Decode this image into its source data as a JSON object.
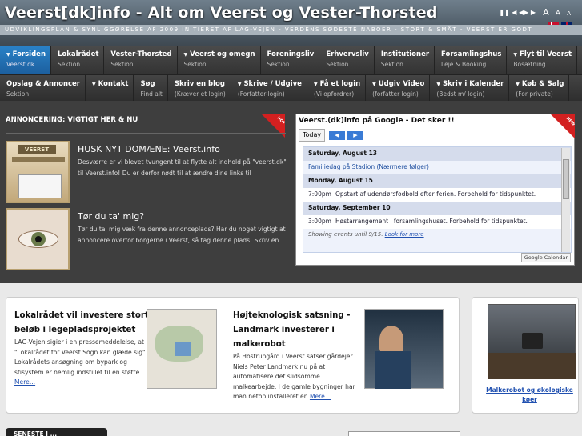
{
  "header": {
    "title": "Veerst[dk]info - Alt om Veerst og Vester-Thorsted",
    "tagline": "UDVIKLINGSPLAN & SYNLIGGØRELSE AF 2009 INITIERET AF LAG-VEJEN - VERDENS SØDESTE NABOER - STORT & SMÅT - VEERST ER GODT",
    "slideshow_controls": "❚❚ ◀ ◀▶ ▶",
    "font_controls": [
      "A",
      "A",
      "A"
    ]
  },
  "nav1": [
    {
      "label": "Forsiden",
      "sub": "Veerst.dk",
      "caret": true,
      "active": true
    },
    {
      "label": "Lokalrådet",
      "sub": "Sektion",
      "caret": false
    },
    {
      "label": "Vester-Thorsted",
      "sub": "Sektion",
      "caret": false
    },
    {
      "label": "Veerst og omegn",
      "sub": "Sektion",
      "caret": true
    },
    {
      "label": "Foreningsliv",
      "sub": "Sektion",
      "caret": false
    },
    {
      "label": "Erhvervsliv",
      "sub": "Sektion",
      "caret": false
    },
    {
      "label": "Institutioner",
      "sub": "Sektion",
      "caret": false
    },
    {
      "label": "Forsamlingshus",
      "sub": "Leje & Booking",
      "caret": false
    },
    {
      "label": "Flyt til Veerst",
      "sub": "Bosætning",
      "caret": true
    }
  ],
  "nav2": [
    {
      "label": "Opslag & Annoncer",
      "sub": "Sektion",
      "caret": false
    },
    {
      "label": "Kontakt",
      "sub": "",
      "caret": true
    },
    {
      "label": "Søg",
      "sub": "Find alt",
      "caret": false
    },
    {
      "label": "Skriv en blog",
      "sub": "(Kræver et login)",
      "caret": false
    },
    {
      "label": "Skrive / Udgive",
      "sub": "(Forfatter-login)",
      "caret": true
    },
    {
      "label": "Få et login",
      "sub": "(Vi opfordrer)",
      "caret": true
    },
    {
      "label": "Udgiv Video",
      "sub": "(forfatter login)",
      "caret": true
    },
    {
      "label": "Skriv i Kalender",
      "sub": "(Bedst m/ login)",
      "caret": true
    },
    {
      "label": "Køb & Salg",
      "sub": "(For private)",
      "caret": true
    }
  ],
  "announcements": {
    "heading": "ANNONCERING: VIGTIGT HER & NU",
    "ribbon": "HOT",
    "items": [
      {
        "title": "HUSK NYT DOMÆNE: Veerst.info",
        "text": "Desværre er vi blevet tvungent til at flytte alt indhold på \"veerst.dk\" til Veerst.info! Du er derfor nødt til at ændre dine links til"
      },
      {
        "title": "Tør du ta' mig?",
        "text": "Tør du ta' mig væk fra denne annonceplads? Har du noget vigtigt at annoncere overfor borgerne i Veerst, så tag denne plads! Skriv en"
      }
    ]
  },
  "calendar": {
    "title": "Veerst.(dk)info på Google - Det sker !!",
    "ribbon": "NEW",
    "today_button": "Today",
    "prev_arrow": "◀",
    "next_arrow": "▶",
    "rows": [
      {
        "type": "date",
        "text": "Saturday, August 13"
      },
      {
        "type": "event",
        "time": "",
        "text": "Familiedag på Stadion (Nærmere følger)",
        "blue": true
      },
      {
        "type": "date",
        "text": "Monday, August 15"
      },
      {
        "type": "event",
        "time": "7:00pm",
        "text": "Opstart af udendørsfodbold efter ferien. Forbehold for tidspunktet.",
        "blue": false
      },
      {
        "type": "date",
        "text": "Saturday, September 10"
      },
      {
        "type": "event",
        "time": "3:00pm",
        "text": "Høstarrangement i forsamlingshuset. Forbehold for tidspunktet.",
        "blue": false
      }
    ],
    "footer_text": "Showing events until 9/15.",
    "footer_link": "Look for more",
    "badge": "Google Calendar"
  },
  "news": [
    {
      "title": "Lokalrådet vil investere stort beløb i legepladsprojektet",
      "text": "LAG-Vejen sigier i en pressemeddelelse, at \"Lokalrådet for Veerst Sogn kan glæde sig\" Lokalrådets ansøgning om bypark og stisystem er nemlig indstillet til en støtte",
      "more": "Mere..."
    },
    {
      "title": "Højteknologisk satsning - Landmark investerer i malkerobot",
      "text": "På Hostrupgård i Veerst satser gårdejer Niels Peter Landmark nu på at automatisere det slidsomme malkearbejde. I de gamle bygninger har man netop installeret en",
      "more": "Mere..."
    }
  ],
  "video_caption": "Malkerobot og økologiske køer",
  "latest_tab": "SENESTE I ..."
}
